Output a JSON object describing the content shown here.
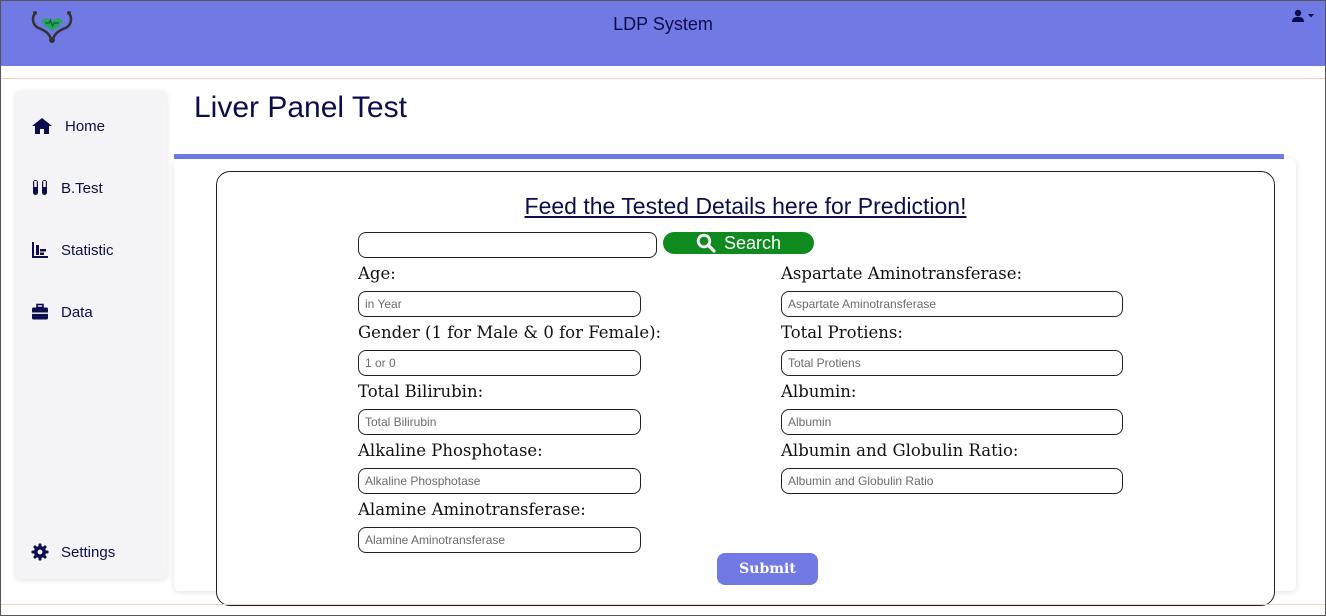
{
  "header": {
    "app_title": "LDP System",
    "logo_icon": "stethoscope-logo-icon",
    "user_icon": "user-icon",
    "accent_color": "#717ae4"
  },
  "sidebar": {
    "items": [
      {
        "label": "Home",
        "icon": "home-icon"
      },
      {
        "label": "B.Test",
        "icon": "test-tubes-icon"
      },
      {
        "label": "Statistic",
        "icon": "bar-chart-icon"
      },
      {
        "label": "Data",
        "icon": "briefcase-icon"
      },
      {
        "label": "Settings",
        "icon": "gear-icon"
      }
    ]
  },
  "page": {
    "title": "Liver Panel Test"
  },
  "form": {
    "heading": "Feed the Tested Details here for Prediction!",
    "search": {
      "value": "",
      "button_label": "Search",
      "button_color": "#0f8a1f"
    },
    "left_fields": [
      {
        "label": "Age:",
        "placeholder": "in Year",
        "value": ""
      },
      {
        "label": "Gender (1 for Male & 0 for Female):",
        "placeholder": "1 or 0",
        "value": ""
      },
      {
        "label": "Total Bilirubin:",
        "placeholder": "Total Bilirubin",
        "value": ""
      },
      {
        "label": "Alkaline Phosphotase:",
        "placeholder": "Alkaline Phosphotase",
        "value": ""
      },
      {
        "label": "Alamine Aminotransferase:",
        "placeholder": "Alamine Aminotransferase",
        "value": ""
      }
    ],
    "right_fields": [
      {
        "label": "Aspartate Aminotransferase:",
        "placeholder": "Aspartate Aminotransferase",
        "value": ""
      },
      {
        "label": "Total Protiens:",
        "placeholder": "Total Protiens",
        "value": ""
      },
      {
        "label": "Albumin:",
        "placeholder": "Albumin",
        "value": ""
      },
      {
        "label": "Albumin and Globulin Ratio:",
        "placeholder": "Albumin and Globulin Ratio",
        "value": ""
      }
    ],
    "submit_label": "Submit"
  }
}
